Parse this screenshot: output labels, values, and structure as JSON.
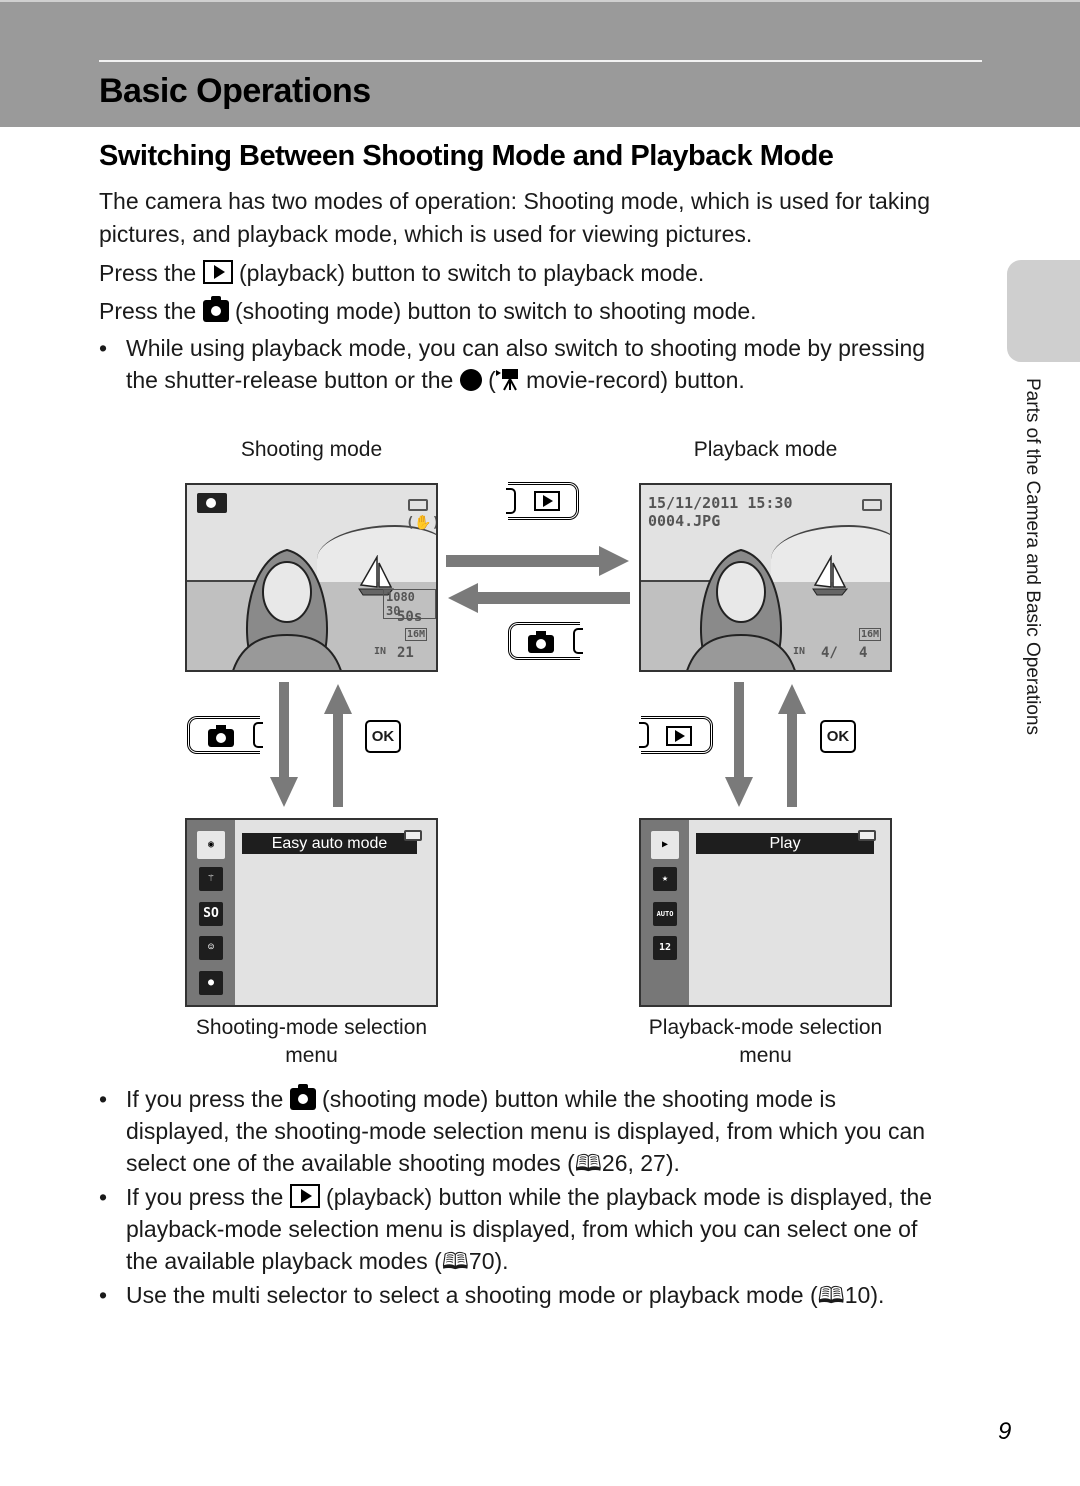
{
  "header": {
    "chapter_title": "Basic Operations"
  },
  "section_title": "Switching Between Shooting Mode and Playback Mode",
  "intro": {
    "line1": "The camera has two modes of operation: Shooting mode, which is used for taking",
    "line2": "pictures, and playback mode, which is used for viewing pictures.",
    "playback_pre": "Press the",
    "playback_icon": "playback-button-icon",
    "playback_post": "(playback) button to switch to playback mode.",
    "shooting_pre": "Press the",
    "shooting_icon": "shooting-mode-button-icon",
    "shooting_post": "(shooting mode) button to switch to shooting mode."
  },
  "note_bullet": {
    "line1": "While using playback mode, you can also switch to shooting mode by pressing",
    "line2_pre": "the shutter-release button or the",
    "line2_paren": "(",
    "line2_post": "movie-record) button."
  },
  "diagram": {
    "shooting_label": "Shooting mode",
    "playback_label": "Playback mode",
    "shooting_screen": {
      "mode_icon": "easy-auto-mode-icon",
      "video_mode": "1080 30",
      "rec_time": "50s",
      "image_size": "16M",
      "internal_memory": "IN",
      "remaining_exposures": "21"
    },
    "playback_screen": {
      "date_time": "15/11/2011  15:30",
      "file_name": "0004.JPG",
      "image_size": "16M",
      "internal_memory": "IN",
      "frame_counter": "4/",
      "frame_total": "4"
    },
    "ok_label": "OK",
    "shooting_menu": {
      "selected_label": "Easy auto mode",
      "items": [
        "easy-auto",
        "scene",
        "SO",
        "smart-portrait",
        "auto"
      ],
      "so_text": "SO",
      "caption_line1": "Shooting-mode selection",
      "caption_line2": "menu"
    },
    "playback_menu": {
      "selected_label": "Play",
      "items": [
        "play",
        "favorite-pictures",
        "auto-sort",
        "list-by-date"
      ],
      "auto_text": "AUTO",
      "date_text": "12",
      "caption_line1": "Playback-mode selection",
      "caption_line2": "menu"
    }
  },
  "bullets": [
    {
      "pre": "If you press the",
      "icon": "shooting-mode-button-icon",
      "post": "(shooting mode) button while the shooting mode is",
      "line2": "displayed, the shooting-mode selection menu is displayed, from which you can",
      "line3": "select one of the available shooting modes (",
      "ref": "26, 27)."
    },
    {
      "pre": "If you press the",
      "icon": "playback-button-icon",
      "post": "(playback) button while the playback mode is displayed, the",
      "line2": "playback-mode selection menu is displayed, from which you can select one of",
      "line3": "the available playback modes (",
      "ref": "70)."
    },
    {
      "line1": "Use the multi selector to select a shooting mode or playback mode (",
      "ref": "10)."
    }
  ],
  "bullet_char": "•",
  "book_glyph": "🕮",
  "side_tab": {
    "label": "Parts of the Camera and Basic Operations"
  },
  "page_number": "9"
}
